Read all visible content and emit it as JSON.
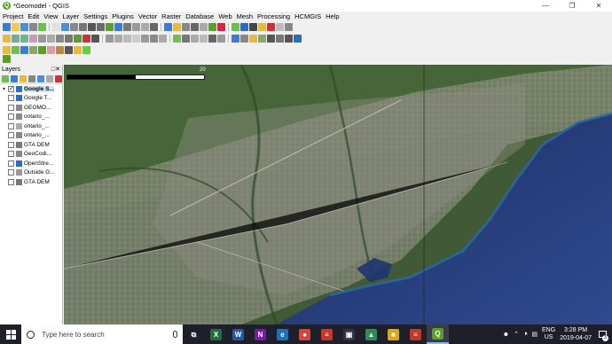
{
  "window": {
    "title": "*Geomodel - QGIS",
    "min": "—",
    "max": "❐",
    "close": "✕"
  },
  "menu": [
    "Project",
    "Edit",
    "View",
    "Layer",
    "Settings",
    "Plugins",
    "Vector",
    "Raster",
    "Database",
    "Web",
    "Mesh",
    "Processing",
    "HCMGIS",
    "Help"
  ],
  "layers_panel": {
    "title": "Layers",
    "controls": "□✕",
    "items": [
      {
        "label": "Google S...",
        "checked": true,
        "selected": true,
        "icon": "raster-icon",
        "icon_color": "#2a6cc4",
        "expand": "▾"
      },
      {
        "label": "Google T...",
        "checked": false,
        "icon": "raster-icon",
        "icon_color": "#2a6cc4"
      },
      {
        "label": "GEOMO...",
        "checked": false,
        "icon": "point-layer-icon",
        "icon_color": "#888888"
      },
      {
        "label": "ontario_...",
        "checked": false,
        "icon": "line-layer-icon",
        "icon_color": "#888888"
      },
      {
        "label": "ontario_...",
        "checked": false,
        "icon": "polygon-layer-icon",
        "icon_color": "#aaaaaa"
      },
      {
        "label": "ontario_...",
        "checked": false,
        "icon": "line-layer-icon",
        "icon_color": "#888888"
      },
      {
        "label": "GTA DEM",
        "checked": false,
        "icon": "raster-icon",
        "icon_color": "#777777"
      },
      {
        "label": "GeoCodi...",
        "checked": false,
        "icon": "point-layer-icon",
        "icon_color": "#888888"
      },
      {
        "label": "OpenStre...",
        "checked": false,
        "icon": "raster-icon",
        "icon_color": "#2a6cc4"
      },
      {
        "label": "Outside G...",
        "checked": false,
        "icon": "polygon-layer-icon",
        "icon_color": "#999999"
      },
      {
        "label": "GTA DEM",
        "checked": false,
        "icon": "raster-icon",
        "icon_color": "#777777"
      }
    ]
  },
  "map": {
    "scale_label": "20"
  },
  "taskbar": {
    "search_placeholder": "Type here to search",
    "apps": [
      {
        "name": "task-view",
        "glyph": "⧉",
        "color": "#1f1f2b"
      },
      {
        "name": "excel",
        "glyph": "X",
        "color": "#1d6f42"
      },
      {
        "name": "word",
        "glyph": "W",
        "color": "#2b579a"
      },
      {
        "name": "onenote",
        "glyph": "N",
        "color": "#7719aa"
      },
      {
        "name": "edge",
        "glyph": "e",
        "color": "#1f6fb5"
      },
      {
        "name": "chrome",
        "glyph": "●",
        "color": "#db4437"
      },
      {
        "name": "app-stripes",
        "glyph": "≡",
        "color": "#c0392b"
      },
      {
        "name": "monitor",
        "glyph": "▣",
        "color": "#333344"
      },
      {
        "name": "app-green",
        "glyph": "▲",
        "color": "#2e8b57"
      },
      {
        "name": "folder",
        "glyph": "■",
        "color": "#e0a800"
      },
      {
        "name": "app-red",
        "glyph": "≡",
        "color": "#c0392b"
      },
      {
        "name": "qgis",
        "glyph": "Q",
        "color": "#5b9e2a",
        "active": true
      }
    ],
    "tray": {
      "lang_top": "ENG",
      "lang_bottom": "US",
      "time": "3:28 PM",
      "date": "2019-04-07",
      "notifications": "3"
    }
  }
}
